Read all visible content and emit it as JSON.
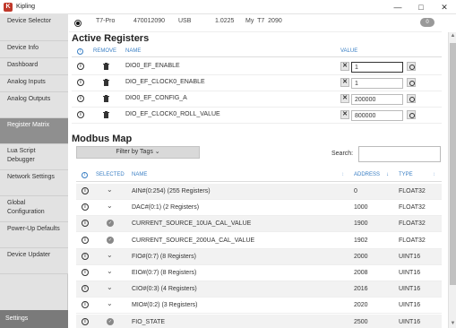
{
  "window": {
    "title": "Kipling",
    "minimize": "—",
    "maximize": "□",
    "close": "✕"
  },
  "sidebar": {
    "items": [
      {
        "label": "Device Selector",
        "active": false
      },
      {
        "label": "Device Info",
        "active": false
      },
      {
        "label": "Dashboard",
        "active": false
      },
      {
        "label": "Analog Inputs",
        "active": false
      },
      {
        "label": "Analog Outputs",
        "active": false
      },
      {
        "label": "Register Matrix",
        "active": true
      },
      {
        "label": "Lua Script Debugger",
        "active": false
      },
      {
        "label": "Network Settings",
        "active": false
      },
      {
        "label": "Global Configuration",
        "active": false
      },
      {
        "label": "Power-Up Defaults",
        "active": false
      },
      {
        "label": "Device Updater",
        "active": false
      }
    ],
    "settings": "Settings"
  },
  "device": {
    "model": "T7-Pro",
    "serial": "470012090",
    "connection": "USB",
    "firmware": "1.0225",
    "name": "My  T7  2090",
    "badge": "0"
  },
  "active_registers": {
    "title": "Active Registers",
    "headers": {
      "remove": "REMOVE",
      "name": "NAME",
      "value": "VALUE"
    },
    "rows": [
      {
        "name": "DIO0_EF_ENABLE",
        "value": "1"
      },
      {
        "name": "DIO_EF_CLOCK0_ENABLE",
        "value": "1"
      },
      {
        "name": "DIO0_EF_CONFIG_A",
        "value": "200000"
      },
      {
        "name": "DIO_EF_CLOCK0_ROLL_VALUE",
        "value": "800000"
      }
    ]
  },
  "modbus_map": {
    "title": "Modbus Map",
    "filter_label": "Filter by Tags ⌄",
    "search_label": "Search:",
    "search_value": "",
    "headers": {
      "selected": "SELECTED",
      "name": "NAME",
      "address": "ADDRESS",
      "type": "TYPE"
    },
    "rows": [
      {
        "name": "AIN#(0:254) (255 Registers)",
        "address": "0",
        "type": "FLOAT32",
        "kind": "group"
      },
      {
        "name": "DAC#(0:1) (2 Registers)",
        "address": "1000",
        "type": "FLOAT32",
        "kind": "group"
      },
      {
        "name": "CURRENT_SOURCE_10UA_CAL_VALUE",
        "address": "1900",
        "type": "FLOAT32",
        "kind": "selected"
      },
      {
        "name": "CURRENT_SOURCE_200UA_CAL_VALUE",
        "address": "1902",
        "type": "FLOAT32",
        "kind": "selected"
      },
      {
        "name": "FIO#(0:7) (8 Registers)",
        "address": "2000",
        "type": "UINT16",
        "kind": "group"
      },
      {
        "name": "EIO#(0:7) (8 Registers)",
        "address": "2008",
        "type": "UINT16",
        "kind": "group"
      },
      {
        "name": "CIO#(0:3) (4 Registers)",
        "address": "2016",
        "type": "UINT16",
        "kind": "group"
      },
      {
        "name": "MIO#(0:2) (3 Registers)",
        "address": "2020",
        "type": "UINT16",
        "kind": "group"
      },
      {
        "name": "FIO_STATE",
        "address": "2500",
        "type": "UINT16",
        "kind": "selected"
      }
    ]
  }
}
